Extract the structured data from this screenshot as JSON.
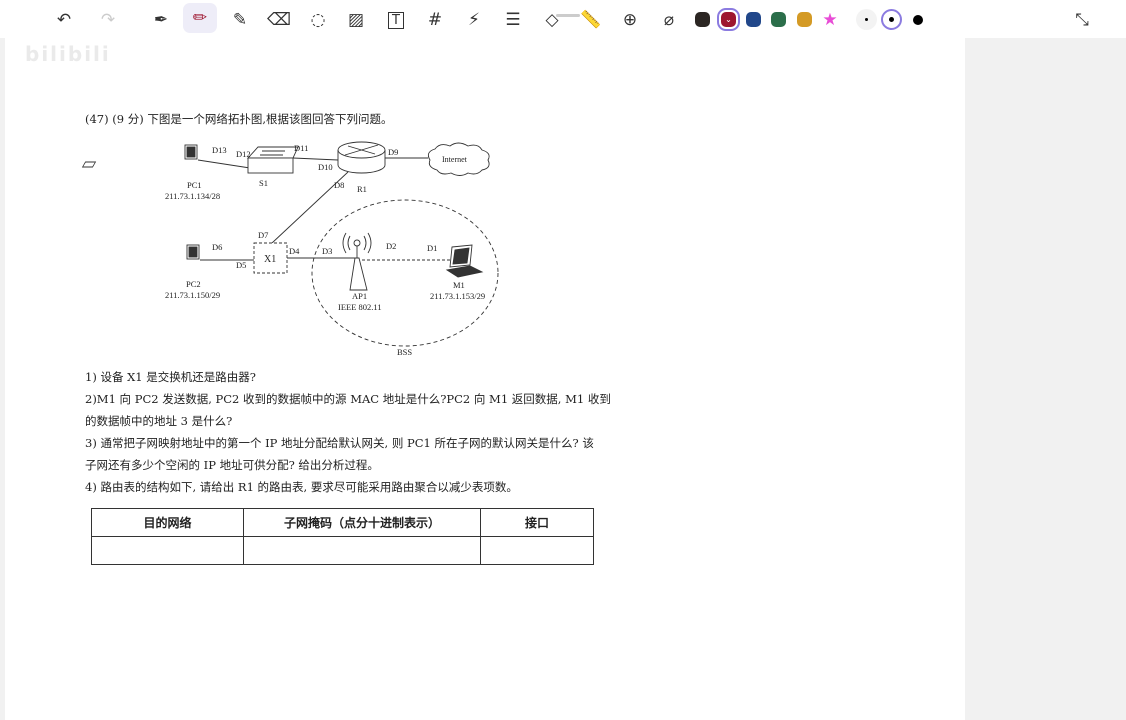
{
  "toolbar": {
    "tools": [
      "undo-icon",
      "redo-icon",
      "pen-icon",
      "pencil-icon",
      "highlighter-icon",
      "eraser-icon",
      "lasso-icon",
      "image-icon",
      "text-icon",
      "hashtag-icon",
      "laser-icon",
      "text-select-icon",
      "shapes-icon",
      "ruler-icon",
      "zoom-icon",
      "tape-icon"
    ],
    "active_tool": "pencil",
    "colors": [
      "#2b2623",
      "#9e1630",
      "#21478a",
      "#2b6e4a",
      "#d49a25",
      "#e84cd6"
    ],
    "selected_color": "#9e1630",
    "stroke_sizes": [
      "small",
      "medium",
      "large"
    ],
    "selected_size": "medium",
    "collapse": "collapse-icon"
  },
  "watermark": "bilibili",
  "question": {
    "title": "(47) (9 分) 下图是一个网络拓扑图,根据该图回答下列问题。",
    "q1": "1) 设备 X1 是交换机还是路由器?",
    "q2a": "2)M1 向 PC2 发送数据, PC2 收到的数据帧中的源 MAC 地址是什么?PC2 向 M1 返回数据, M1 收到",
    "q2b": "的数据帧中的地址 3 是什么?",
    "q3a": "3) 通常把子网映射地址中的第一个 IP 地址分配给默认网关, 则 PC1 所在子网的默认网关是什么? 该",
    "q3b": "子网还有多少个空闲的 IP 地址可供分配? 给出分析过程。",
    "q4": "4) 路由表的结构如下, 请给出 R1 的路由表, 要求尽可能采用路由聚合以减少表项数。"
  },
  "diagram": {
    "pc1": "PC1",
    "pc1_ip": "211.73.1.134/28",
    "s1": "S1",
    "r1": "R1",
    "internet": "Internet",
    "pc2": "PC2",
    "pc2_ip": "211.73.1.150/29",
    "x1": "X1",
    "ap1": "AP1",
    "ap1_std": "IEEE 802.11",
    "m1": "M1",
    "m1_ip": "211.73.1.153/29",
    "bss": "BSS",
    "ports": {
      "d1": "D1",
      "d2": "D2",
      "d3": "D3",
      "d4": "D4",
      "d5": "D5",
      "d6": "D6",
      "d7": "D7",
      "d8": "D8",
      "d9": "D9",
      "d10": "D10",
      "d11": "D11",
      "d12": "D12",
      "d13": "D13"
    }
  },
  "table": {
    "headers": [
      "目的网络",
      "子网掩码（点分十进制表示）",
      "接口"
    ],
    "rows": [
      [
        "",
        "",
        ""
      ]
    ]
  }
}
